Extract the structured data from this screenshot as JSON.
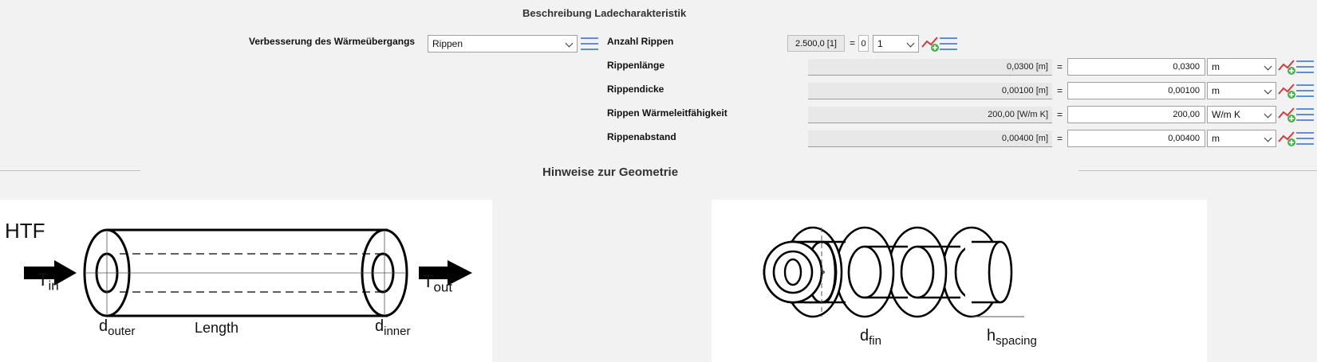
{
  "header": {
    "title": "Beschreibung Ladecharakteristik"
  },
  "improvement": {
    "label": "Verbesserung des Wärmeübergangs",
    "value": "Rippen"
  },
  "fins": {
    "label": "Anzahl Rippen",
    "value": "2.500,0 [1]",
    "eq": "=",
    "sub": "0",
    "select": "1"
  },
  "rows": [
    {
      "label": "Rippenlänge",
      "value": "0,0300 [m]",
      "eq": "=",
      "input": "0,0300",
      "unit": "m"
    },
    {
      "label": "Rippendicke",
      "value": "0,00100 [m]",
      "eq": "=",
      "input": "0,00100",
      "unit": "m"
    },
    {
      "label": "Rippen Wärmeleitfähigkeit",
      "value": "200,00 [W/m K]",
      "eq": "=",
      "input": "200,00",
      "unit": "W/m K"
    },
    {
      "label": "Rippenabstand",
      "value": "0,00400 [m]",
      "eq": "=",
      "input": "0,00400",
      "unit": "m"
    }
  ],
  "geometry": {
    "title": "Hinweise zur Geometrie",
    "tube": {
      "htf": "HTF",
      "t_in": "T",
      "t_in_sub": "in",
      "t_out": "T",
      "t_out_sub": "out",
      "d_outer": "d",
      "d_outer_sub": "outer",
      "length": "Length",
      "d_inner": "d",
      "d_inner_sub": "inner"
    },
    "fin": {
      "d_fin": "d",
      "d_fin_sub": "fin",
      "h_spacing": "h",
      "h_spacing_sub": "spacing"
    }
  },
  "icons": {
    "menu": "list-menu-icon",
    "trend": "trend-chart-add-icon",
    "accent": "#5e8fd6"
  }
}
